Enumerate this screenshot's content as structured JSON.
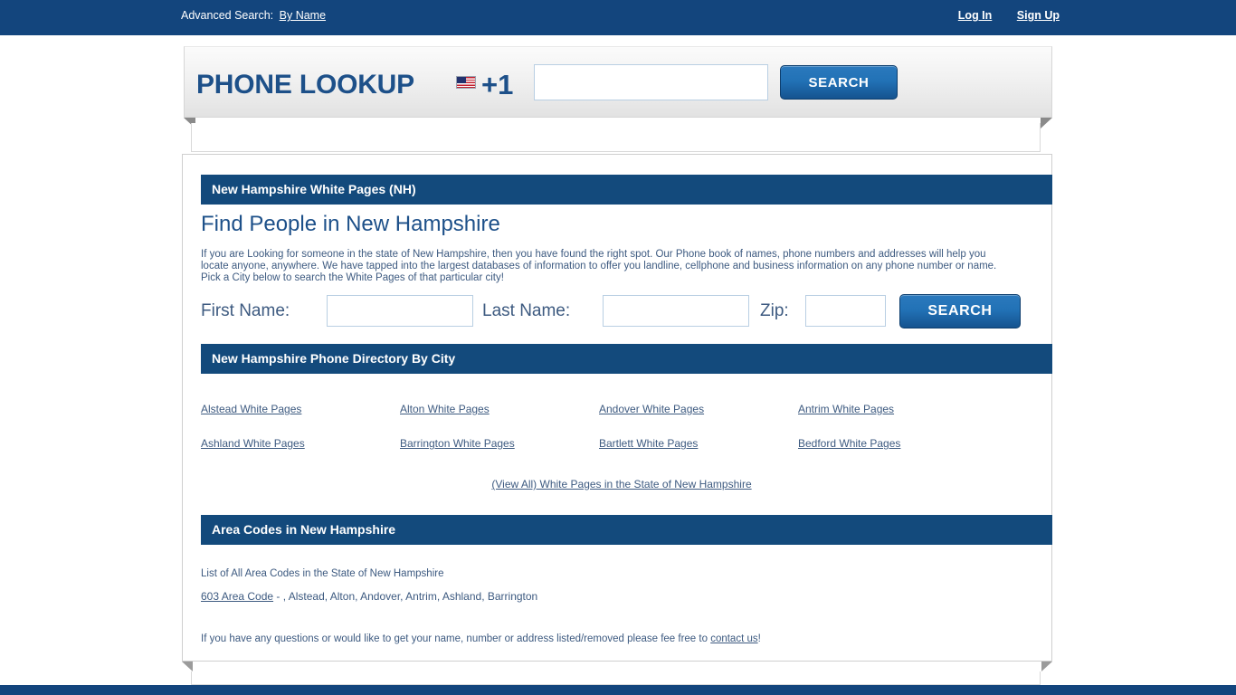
{
  "topbar": {
    "advanced_search_label": "Advanced Search:",
    "by_name_link": "By Name",
    "login_link": "Log In",
    "signup_link": "Sign Up"
  },
  "banner": {
    "title": "PHONE LOOKUP",
    "country_code": "+1",
    "flag_icon": "us-flag-icon",
    "phone_value": "",
    "phone_placeholder": "",
    "search_button": "SEARCH"
  },
  "state_section": {
    "header": "New Hampshire White Pages (NH)",
    "heading": "Find People in New Hampshire",
    "intro": "If you are Looking for someone in the state of New Hampshire, then you have found the right spot. Our Phone book of names, phone numbers and addresses will help you locate anyone, anywhere. We have tapped into the largest databases of information to offer you landline, cellphone and business information on any phone number or name. Pick a City below to search the White Pages of that particular city!"
  },
  "name_form": {
    "first_label": "First Name:",
    "first_value": "",
    "last_label": "Last Name:",
    "last_value": "",
    "zip_label": "Zip:",
    "zip_value": "",
    "search_button": "SEARCH"
  },
  "city_section": {
    "header": "New Hampshire Phone Directory By City",
    "cities": [
      "Alstead White Pages",
      "Alton White Pages",
      "Andover White Pages",
      "Antrim White Pages",
      "Ashland White Pages",
      "Barrington White Pages",
      "Bartlett White Pages",
      "Bedford White Pages"
    ],
    "view_all": "(View All) White Pages in the State of New Hampshire"
  },
  "area_code_section": {
    "header": "Area Codes in New Hampshire",
    "list_intro": "List of All Area Codes in the State of New Hampshire",
    "code_link": "603 Area Code",
    "code_cities": " - , Alstead, Alton, Andover, Antrim, Ashland, Barrington"
  },
  "contact": {
    "text_before": "If you have any questions or would like to get your name, number or address listed/removed please fee free to ",
    "link": "contact us",
    "text_after": "!"
  },
  "colors": {
    "navy": "#13457d",
    "section_navy": "#134a7c",
    "link_blue": "#3d5a80",
    "title_blue": "#1d5089",
    "button_blue": "#2272b6"
  }
}
